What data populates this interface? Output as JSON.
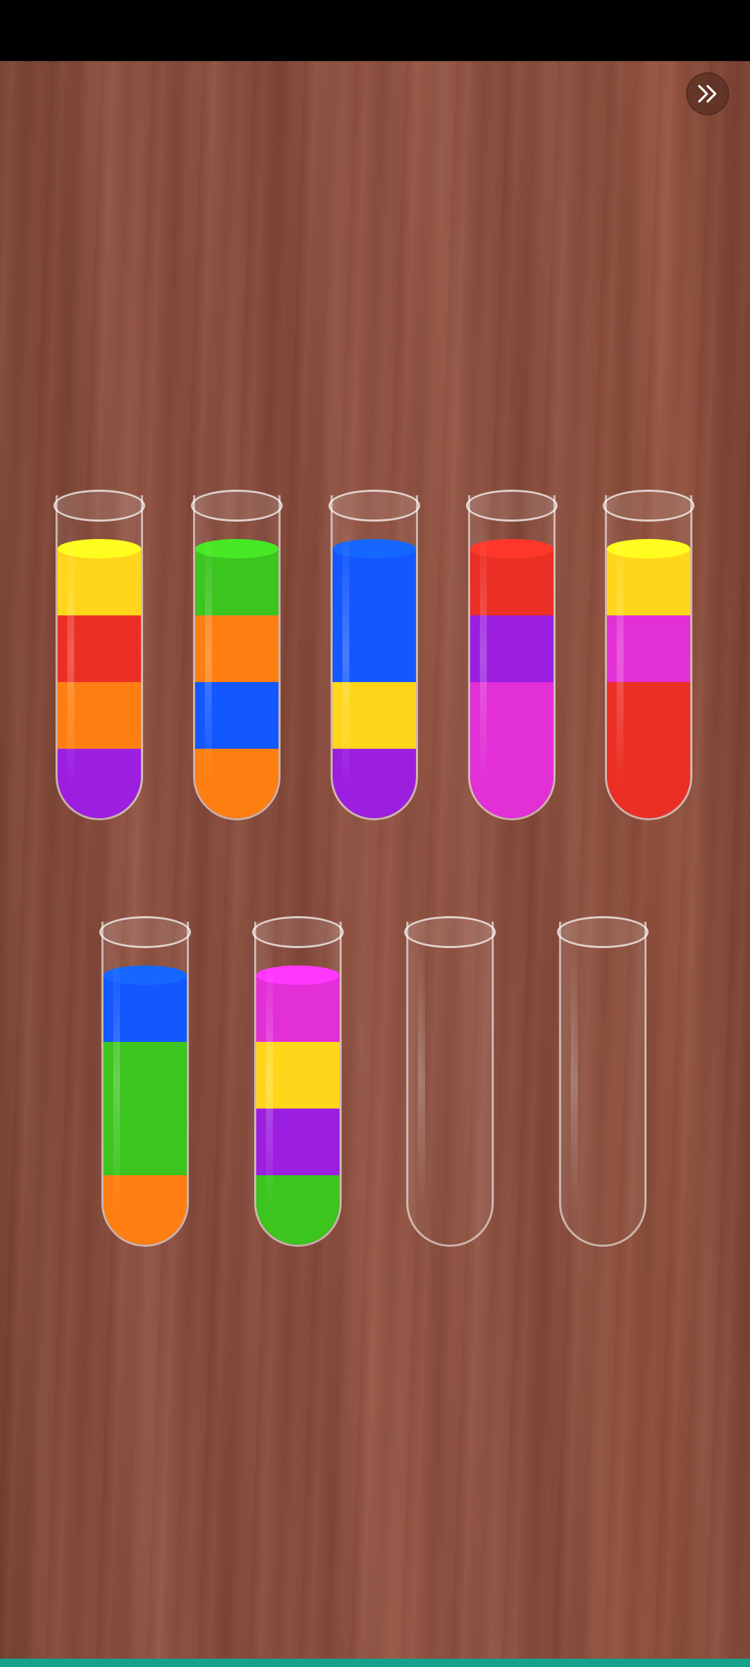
{
  "status_bar": {
    "background": "#000000"
  },
  "board": {
    "wood_color": "#8e5141"
  },
  "skip_button": {
    "icon": "double-chevron-right-icon"
  },
  "palette": {
    "yellow": "#ffd61a",
    "red": "#ec2f24",
    "orange": "#ff7e12",
    "purple": "#9c1fe0",
    "green": "#3cc41f",
    "blue": "#1357ff",
    "pink": "#e22fd6"
  },
  "tubes": [
    {
      "layers_bottom_to_top": [
        "purple",
        "orange",
        "red",
        "yellow"
      ]
    },
    {
      "layers_bottom_to_top": [
        "orange",
        "blue",
        "orange",
        "green"
      ]
    },
    {
      "layers_bottom_to_top": [
        "purple",
        "yellow",
        "blue",
        "blue"
      ]
    },
    {
      "layers_bottom_to_top": [
        "pink",
        "pink",
        "purple",
        "red"
      ]
    },
    {
      "layers_bottom_to_top": [
        "red",
        "red",
        "pink",
        "yellow"
      ]
    },
    {
      "layers_bottom_to_top": [
        "orange",
        "green",
        "green",
        "blue"
      ]
    },
    {
      "layers_bottom_to_top": [
        "green",
        "purple",
        "yellow",
        "pink"
      ]
    },
    {
      "layers_bottom_to_top": []
    },
    {
      "layers_bottom_to_top": []
    }
  ]
}
